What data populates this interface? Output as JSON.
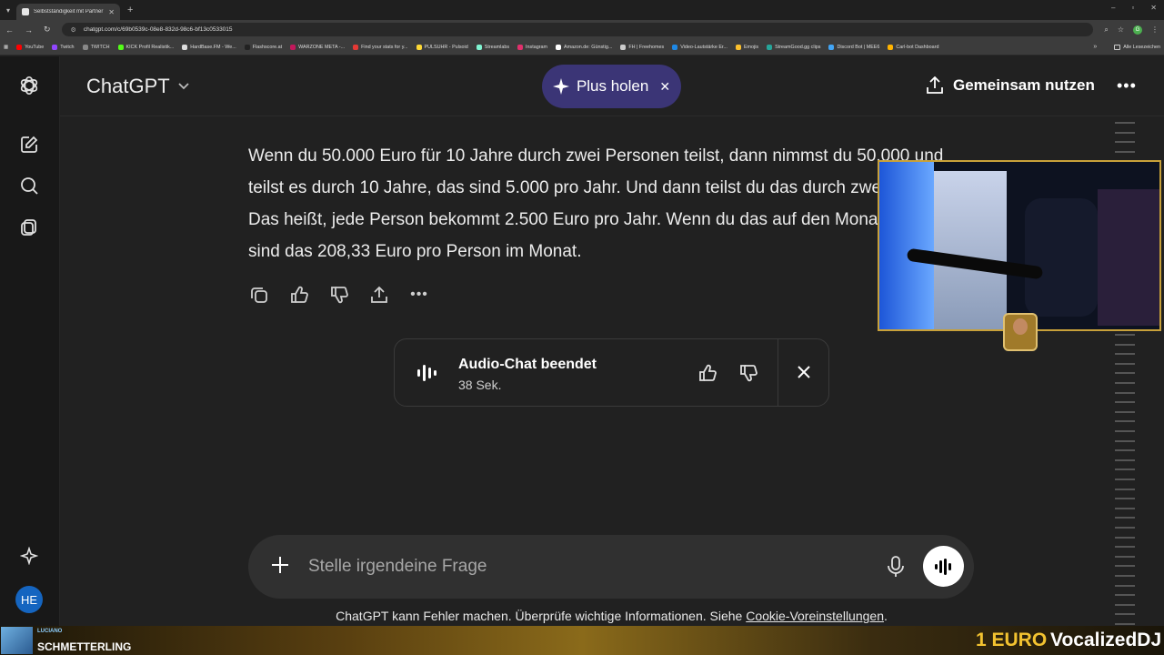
{
  "browser": {
    "tab_title": "Selbstständigkeit mit Partner",
    "url": "chatgpt.com/c/69b0539c-08e8-832d-98c6-bf13c0533015",
    "profile_initial": "G",
    "bookmarks": [
      {
        "label": "YouTube",
        "color": "#ff0000"
      },
      {
        "label": "Twitch",
        "color": "#9146ff"
      },
      {
        "label": "TWITCH",
        "color": "#888888"
      },
      {
        "label": "KICK Profil Realistik...",
        "color": "#53fc18"
      },
      {
        "label": "HardBase.FM - We...",
        "color": "#dddddd"
      },
      {
        "label": "Flashscore.at",
        "color": "#222222"
      },
      {
        "label": "WARZONE META -...",
        "color": "#c2185b"
      },
      {
        "label": "Find your stats for y...",
        "color": "#e53935"
      },
      {
        "label": "PULSUHR - Pulsoid",
        "color": "#fdd835"
      },
      {
        "label": "Streamlabs",
        "color": "#80f5d2"
      },
      {
        "label": "Instagram",
        "color": "#e1306c"
      },
      {
        "label": "Amazon.de: Günstig...",
        "color": "#ffffff"
      },
      {
        "label": "FH | Freehomes",
        "color": "#cccccc"
      },
      {
        "label": "Video-Lautstärke Er...",
        "color": "#1e88e5"
      },
      {
        "label": "Emojis",
        "color": "#fbc02d"
      },
      {
        "label": "StreamGood.gg clips",
        "color": "#26a69a"
      },
      {
        "label": "Discord Bot | MEE6",
        "color": "#42a5f5"
      },
      {
        "label": "Carl-bot Dashboard",
        "color": "#ffb300"
      }
    ],
    "all_bookmarks": "Alle Lesezeichen"
  },
  "header": {
    "model": "ChatGPT",
    "upgrade": "Plus holen",
    "share": "Gemeinsam nutzen"
  },
  "message": {
    "text": "Wenn du 50.000 Euro für 10 Jahre durch zwei Personen teilst, dann nimmst du 50.000 und teilst es durch 10 Jahre, das sind 5.000 pro Jahr. Und dann teilst du das durch zwei Personen. Das heißt, jede Person bekommt 2.500 Euro pro Jahr. Wenn du das auf den Monat umlegst, sind das 208,33 Euro pro Person im Monat."
  },
  "audio_chat": {
    "title": "Audio-Chat beendet",
    "duration": "38 Sek."
  },
  "composer": {
    "placeholder": "Stelle irgendeine Frage"
  },
  "disclaimer": {
    "text": "ChatGPT kann Fehler machen. Überprüfe wichtige Informationen. Siehe ",
    "link": "Cookie-Voreinstellungen",
    "suffix": "."
  },
  "sidebar": {
    "avatar_initials": "HE"
  },
  "stream_overlay": {
    "label_top": "LUCIANO",
    "label_name": "SCHMETTERLING",
    "donation_amount": "1 EURO",
    "donor": "VocalizedDJ"
  }
}
